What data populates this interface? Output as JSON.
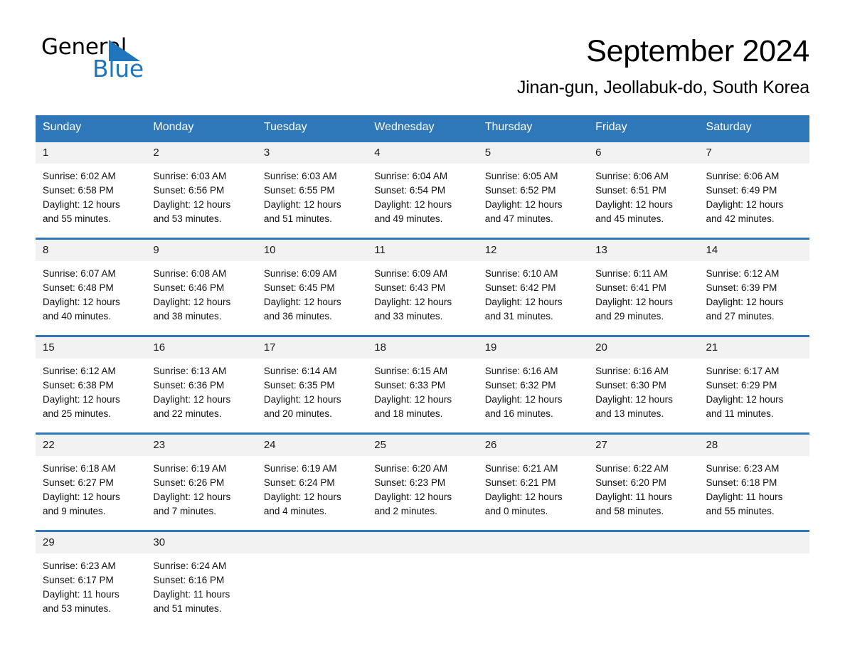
{
  "brand": {
    "name_dark": "General",
    "name_light": "Blue",
    "triangle_icon": "triangle-icon",
    "accent_color": "#1f76bc"
  },
  "header": {
    "month_title": "September 2024",
    "location": "Jinan-gun, Jeollabuk-do, South Korea"
  },
  "calendar": {
    "header_color": "#2e77b8",
    "daynum_bg": "#f2f2f2",
    "weekdays": [
      "Sunday",
      "Monday",
      "Tuesday",
      "Wednesday",
      "Thursday",
      "Friday",
      "Saturday"
    ],
    "weeks": [
      [
        {
          "day": "1",
          "sunrise": "Sunrise: 6:02 AM",
          "sunset": "Sunset: 6:58 PM",
          "daylight_1": "Daylight: 12 hours",
          "daylight_2": "and 55 minutes."
        },
        {
          "day": "2",
          "sunrise": "Sunrise: 6:03 AM",
          "sunset": "Sunset: 6:56 PM",
          "daylight_1": "Daylight: 12 hours",
          "daylight_2": "and 53 minutes."
        },
        {
          "day": "3",
          "sunrise": "Sunrise: 6:03 AM",
          "sunset": "Sunset: 6:55 PM",
          "daylight_1": "Daylight: 12 hours",
          "daylight_2": "and 51 minutes."
        },
        {
          "day": "4",
          "sunrise": "Sunrise: 6:04 AM",
          "sunset": "Sunset: 6:54 PM",
          "daylight_1": "Daylight: 12 hours",
          "daylight_2": "and 49 minutes."
        },
        {
          "day": "5",
          "sunrise": "Sunrise: 6:05 AM",
          "sunset": "Sunset: 6:52 PM",
          "daylight_1": "Daylight: 12 hours",
          "daylight_2": "and 47 minutes."
        },
        {
          "day": "6",
          "sunrise": "Sunrise: 6:06 AM",
          "sunset": "Sunset: 6:51 PM",
          "daylight_1": "Daylight: 12 hours",
          "daylight_2": "and 45 minutes."
        },
        {
          "day": "7",
          "sunrise": "Sunrise: 6:06 AM",
          "sunset": "Sunset: 6:49 PM",
          "daylight_1": "Daylight: 12 hours",
          "daylight_2": "and 42 minutes."
        }
      ],
      [
        {
          "day": "8",
          "sunrise": "Sunrise: 6:07 AM",
          "sunset": "Sunset: 6:48 PM",
          "daylight_1": "Daylight: 12 hours",
          "daylight_2": "and 40 minutes."
        },
        {
          "day": "9",
          "sunrise": "Sunrise: 6:08 AM",
          "sunset": "Sunset: 6:46 PM",
          "daylight_1": "Daylight: 12 hours",
          "daylight_2": "and 38 minutes."
        },
        {
          "day": "10",
          "sunrise": "Sunrise: 6:09 AM",
          "sunset": "Sunset: 6:45 PM",
          "daylight_1": "Daylight: 12 hours",
          "daylight_2": "and 36 minutes."
        },
        {
          "day": "11",
          "sunrise": "Sunrise: 6:09 AM",
          "sunset": "Sunset: 6:43 PM",
          "daylight_1": "Daylight: 12 hours",
          "daylight_2": "and 33 minutes."
        },
        {
          "day": "12",
          "sunrise": "Sunrise: 6:10 AM",
          "sunset": "Sunset: 6:42 PM",
          "daylight_1": "Daylight: 12 hours",
          "daylight_2": "and 31 minutes."
        },
        {
          "day": "13",
          "sunrise": "Sunrise: 6:11 AM",
          "sunset": "Sunset: 6:41 PM",
          "daylight_1": "Daylight: 12 hours",
          "daylight_2": "and 29 minutes."
        },
        {
          "day": "14",
          "sunrise": "Sunrise: 6:12 AM",
          "sunset": "Sunset: 6:39 PM",
          "daylight_1": "Daylight: 12 hours",
          "daylight_2": "and 27 minutes."
        }
      ],
      [
        {
          "day": "15",
          "sunrise": "Sunrise: 6:12 AM",
          "sunset": "Sunset: 6:38 PM",
          "daylight_1": "Daylight: 12 hours",
          "daylight_2": "and 25 minutes."
        },
        {
          "day": "16",
          "sunrise": "Sunrise: 6:13 AM",
          "sunset": "Sunset: 6:36 PM",
          "daylight_1": "Daylight: 12 hours",
          "daylight_2": "and 22 minutes."
        },
        {
          "day": "17",
          "sunrise": "Sunrise: 6:14 AM",
          "sunset": "Sunset: 6:35 PM",
          "daylight_1": "Daylight: 12 hours",
          "daylight_2": "and 20 minutes."
        },
        {
          "day": "18",
          "sunrise": "Sunrise: 6:15 AM",
          "sunset": "Sunset: 6:33 PM",
          "daylight_1": "Daylight: 12 hours",
          "daylight_2": "and 18 minutes."
        },
        {
          "day": "19",
          "sunrise": "Sunrise: 6:16 AM",
          "sunset": "Sunset: 6:32 PM",
          "daylight_1": "Daylight: 12 hours",
          "daylight_2": "and 16 minutes."
        },
        {
          "day": "20",
          "sunrise": "Sunrise: 6:16 AM",
          "sunset": "Sunset: 6:30 PM",
          "daylight_1": "Daylight: 12 hours",
          "daylight_2": "and 13 minutes."
        },
        {
          "day": "21",
          "sunrise": "Sunrise: 6:17 AM",
          "sunset": "Sunset: 6:29 PM",
          "daylight_1": "Daylight: 12 hours",
          "daylight_2": "and 11 minutes."
        }
      ],
      [
        {
          "day": "22",
          "sunrise": "Sunrise: 6:18 AM",
          "sunset": "Sunset: 6:27 PM",
          "daylight_1": "Daylight: 12 hours",
          "daylight_2": "and 9 minutes."
        },
        {
          "day": "23",
          "sunrise": "Sunrise: 6:19 AM",
          "sunset": "Sunset: 6:26 PM",
          "daylight_1": "Daylight: 12 hours",
          "daylight_2": "and 7 minutes."
        },
        {
          "day": "24",
          "sunrise": "Sunrise: 6:19 AM",
          "sunset": "Sunset: 6:24 PM",
          "daylight_1": "Daylight: 12 hours",
          "daylight_2": "and 4 minutes."
        },
        {
          "day": "25",
          "sunrise": "Sunrise: 6:20 AM",
          "sunset": "Sunset: 6:23 PM",
          "daylight_1": "Daylight: 12 hours",
          "daylight_2": "and 2 minutes."
        },
        {
          "day": "26",
          "sunrise": "Sunrise: 6:21 AM",
          "sunset": "Sunset: 6:21 PM",
          "daylight_1": "Daylight: 12 hours",
          "daylight_2": "and 0 minutes."
        },
        {
          "day": "27",
          "sunrise": "Sunrise: 6:22 AM",
          "sunset": "Sunset: 6:20 PM",
          "daylight_1": "Daylight: 11 hours",
          "daylight_2": "and 58 minutes."
        },
        {
          "day": "28",
          "sunrise": "Sunrise: 6:23 AM",
          "sunset": "Sunset: 6:18 PM",
          "daylight_1": "Daylight: 11 hours",
          "daylight_2": "and 55 minutes."
        }
      ],
      [
        {
          "day": "29",
          "sunrise": "Sunrise: 6:23 AM",
          "sunset": "Sunset: 6:17 PM",
          "daylight_1": "Daylight: 11 hours",
          "daylight_2": "and 53 minutes."
        },
        {
          "day": "30",
          "sunrise": "Sunrise: 6:24 AM",
          "sunset": "Sunset: 6:16 PM",
          "daylight_1": "Daylight: 11 hours",
          "daylight_2": "and 51 minutes."
        },
        {
          "day": "",
          "sunrise": "",
          "sunset": "",
          "daylight_1": "",
          "daylight_2": ""
        },
        {
          "day": "",
          "sunrise": "",
          "sunset": "",
          "daylight_1": "",
          "daylight_2": ""
        },
        {
          "day": "",
          "sunrise": "",
          "sunset": "",
          "daylight_1": "",
          "daylight_2": ""
        },
        {
          "day": "",
          "sunrise": "",
          "sunset": "",
          "daylight_1": "",
          "daylight_2": ""
        },
        {
          "day": "",
          "sunrise": "",
          "sunset": "",
          "daylight_1": "",
          "daylight_2": ""
        }
      ]
    ]
  }
}
